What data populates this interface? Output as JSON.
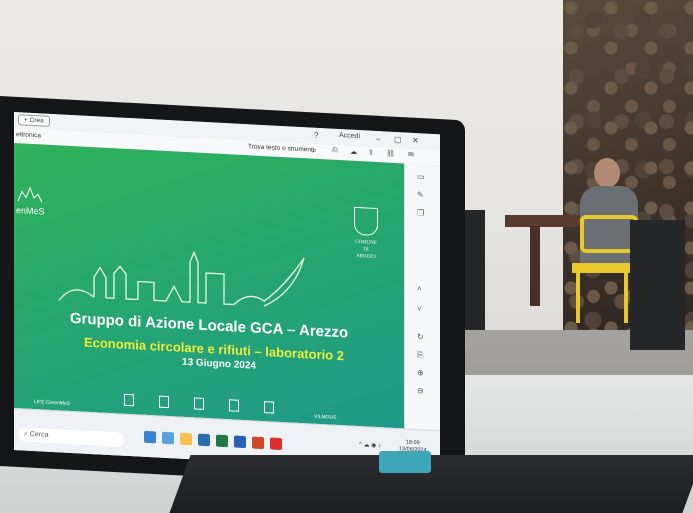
{
  "window": {
    "new_button": "+ Crea",
    "tab_label": "ettronica",
    "signin": "Accedi",
    "search_hint": "Trova testo o strumenti"
  },
  "slide": {
    "logo_text": "enMeS",
    "comune_line1": "COMUNE",
    "comune_line2": "DI",
    "comune_line3": "AREZZO",
    "title": "Gruppo di Azione Locale GCA – Arezzo",
    "subtitle": "Economia circolare e rifiuti – laboratorio 2",
    "date": "13 Giugno 2024",
    "footer_life": "LIFE GreenMeS",
    "footer_vilmous": "VILMOUS"
  },
  "taskbar": {
    "search_placeholder": "Cerca",
    "time": "18:09",
    "date": "13/06/2024"
  },
  "colors": {
    "slide_green": "#2fb25a",
    "subtitle_yellow": "#ecef3a",
    "hinge_teal": "#3ea6b9"
  }
}
